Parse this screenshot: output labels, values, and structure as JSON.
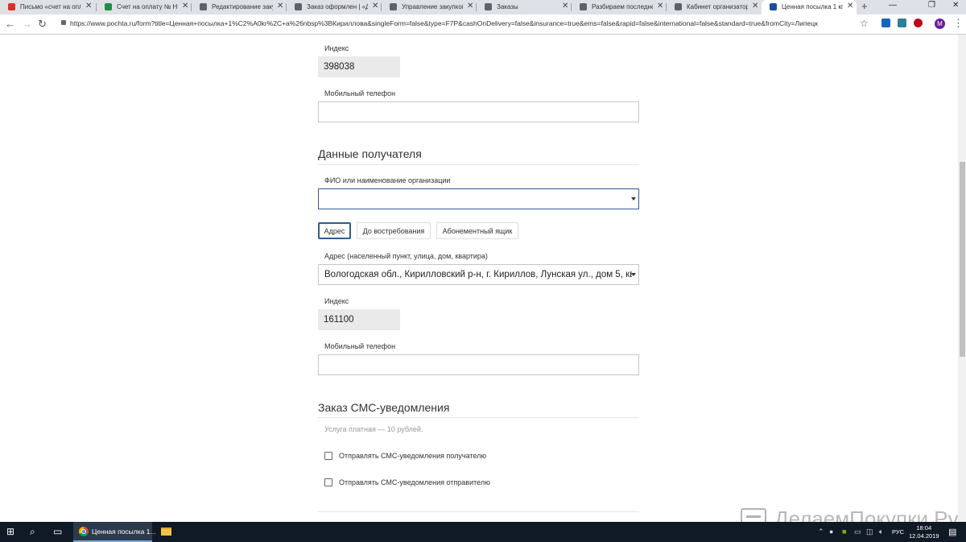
{
  "browser": {
    "tabs": [
      {
        "title": "Письмо «счет на опла",
        "favicon_color": "#d93025"
      },
      {
        "title": "Счет на оплату № Н-3",
        "favicon_color": "#1e8e3e"
      },
      {
        "title": "Редактирование заку",
        "favicon_color": "#5f6368"
      },
      {
        "title": "Заказ оформлен | «Де",
        "favicon_color": "#5f6368"
      },
      {
        "title": "Управление закупкой",
        "favicon_color": "#5f6368"
      },
      {
        "title": "Заказы",
        "favicon_color": "#5f6368"
      },
      {
        "title": "Разбираем последнен",
        "favicon_color": "#5f6368"
      },
      {
        "title": "Кабинет организатор",
        "favicon_color": "#5f6368"
      },
      {
        "title": "Ценная посылка 1 кг",
        "favicon_color": "#1a4f9c"
      }
    ],
    "new_tab": "+",
    "url": "https://www.pochta.ru/form?title=Ценная+посылка+1%C2%A0kr%2C+a%26nbsp%3BКириллова&singleForm=false&type=F7P&cashOnDelivery=false&insurance=true&ems=false&rapid=false&international=false&standard=true&fromCity=Липецк",
    "profile_initial": "M",
    "ext_colors": [
      "#1565c0",
      "#2e7d9a",
      "#bd081c"
    ]
  },
  "form": {
    "sender": {
      "index_label": "Индекс",
      "index_value": "398038",
      "phone_label": "Мобильный телефон",
      "phone_value": ""
    },
    "recipient": {
      "section_title": "Данные получателя",
      "name_label": "ФИО или наименование организации",
      "name_value": "",
      "delivery_options": [
        "Адрес",
        "До востребования",
        "Абонементный ящик"
      ],
      "address_label": "Адрес (населенный пункт, улица, дом, квартира)",
      "address_value": "Вологодская обл., Кирилловский р-н, г. Кириллов, Лунская ул., дом 5, кв",
      "index_label": "Индекс",
      "index_value": "161100",
      "phone_label": "Мобильный телефон",
      "phone_value": ""
    },
    "sms": {
      "section_title": "Заказ СМС-уведомления",
      "note": "Услуга платная — 10 рублей.",
      "opt_recipient": "Отправлять СМС-уведомления получателю",
      "opt_sender": "Отправлять СМС-уведомления отправителю"
    }
  },
  "watermark": "ДелаемПокупки.Ру",
  "taskbar": {
    "window_title": "Ценная посылка 1...",
    "lang": "РУС",
    "time": "18:04",
    "date": "12.04.2019"
  }
}
